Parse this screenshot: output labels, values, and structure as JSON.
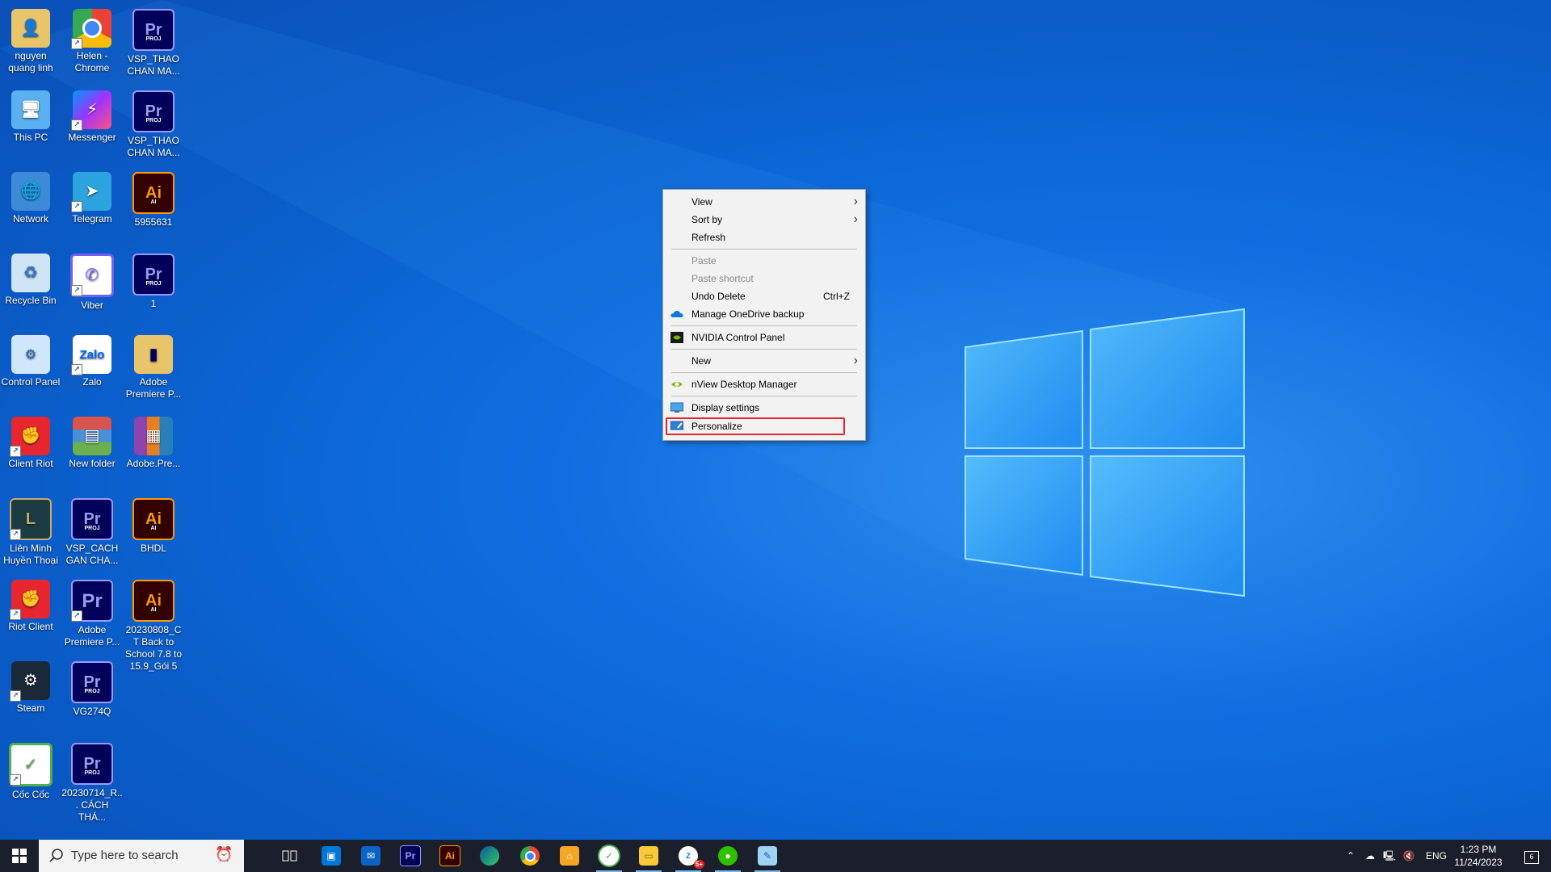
{
  "desktop": {
    "icons": [
      {
        "label": "nguyen quang linh",
        "icon": "user-folder-icon"
      },
      {
        "label": "Helen - Chrome",
        "icon": "chrome-icon"
      },
      {
        "label": "VSP_THAO CHAN MA...",
        "icon": "premiere-project-icon"
      },
      {
        "label": "This PC",
        "icon": "computer-icon"
      },
      {
        "label": "Messenger",
        "icon": "messenger-icon"
      },
      {
        "label": "VSP_THAO CHAN MA...",
        "icon": "premiere-project-icon"
      },
      {
        "label": "Network",
        "icon": "network-icon"
      },
      {
        "label": "Telegram",
        "icon": "telegram-icon"
      },
      {
        "label": "5955631",
        "icon": "illustrator-file-icon"
      },
      {
        "label": "Recycle Bin",
        "icon": "recycle-bin-icon"
      },
      {
        "label": "Viber",
        "icon": "viber-icon"
      },
      {
        "label": "1",
        "icon": "premiere-project-icon"
      },
      {
        "label": "Control Panel",
        "icon": "control-panel-icon"
      },
      {
        "label": "Zalo",
        "icon": "zalo-icon"
      },
      {
        "label": "Adobe Premiere P...",
        "icon": "premiere-folder-icon"
      },
      {
        "label": "Client Riot",
        "icon": "riot-icon"
      },
      {
        "label": "New folder",
        "icon": "winrar-icon"
      },
      {
        "label": "Adobe.Pre...",
        "icon": "winrar-archive-icon"
      },
      {
        "label": "Liên Minh Huyền Thoại",
        "icon": "league-icon"
      },
      {
        "label": "VSP_CACH GAN CHA...",
        "icon": "premiere-project-icon"
      },
      {
        "label": "BHDL",
        "icon": "illustrator-file-icon"
      },
      {
        "label": "Riot Client",
        "icon": "riot-icon"
      },
      {
        "label": "Adobe Premiere P...",
        "icon": "premiere-app-icon"
      },
      {
        "label": "20230808_CT Back to School 7.8 to 15.9_Gói 5",
        "icon": "illustrator-file-icon"
      },
      {
        "label": "Steam",
        "icon": "steam-icon"
      },
      {
        "label": "VG274Q",
        "icon": "premiere-project-icon"
      },
      {
        "label": "Cốc Cốc",
        "icon": "coccoc-icon"
      },
      {
        "label": "20230714_R... CÁCH THÁ...",
        "icon": "premiere-project-icon"
      }
    ]
  },
  "context_menu": {
    "view": "View",
    "sort_by": "Sort by",
    "refresh": "Refresh",
    "paste": "Paste",
    "paste_shortcut": "Paste shortcut",
    "undo_delete": "Undo Delete",
    "undo_shortcut": "Ctrl+Z",
    "onedrive": "Manage OneDrive backup",
    "nvidia": "NVIDIA Control Panel",
    "new": "New",
    "nview": "nView Desktop Manager",
    "display": "Display settings",
    "personalize": "Personalize"
  },
  "taskbar": {
    "search_placeholder": "Type here to search",
    "apps": [
      "task-view-icon",
      "store-icon",
      "mail-icon",
      "premiere-icon",
      "illustrator-icon",
      "edge-icon",
      "chrome-icon",
      "shop-icon",
      "coccoc-icon",
      "file-explorer-icon",
      "zalo-icon",
      "wechat-icon",
      "notepad-icon"
    ],
    "premiere_label": "Pr",
    "illustrator_label": "Ai",
    "zalo_badge": "5+",
    "language": "ENG",
    "time": "1:23 PM",
    "date": "11/24/2023",
    "notification_count": "6"
  },
  "colors": {
    "highlight_border": "#e3262e",
    "taskbar_bg": "#1b1f2b",
    "menu_bg": "#f2f2f2"
  }
}
